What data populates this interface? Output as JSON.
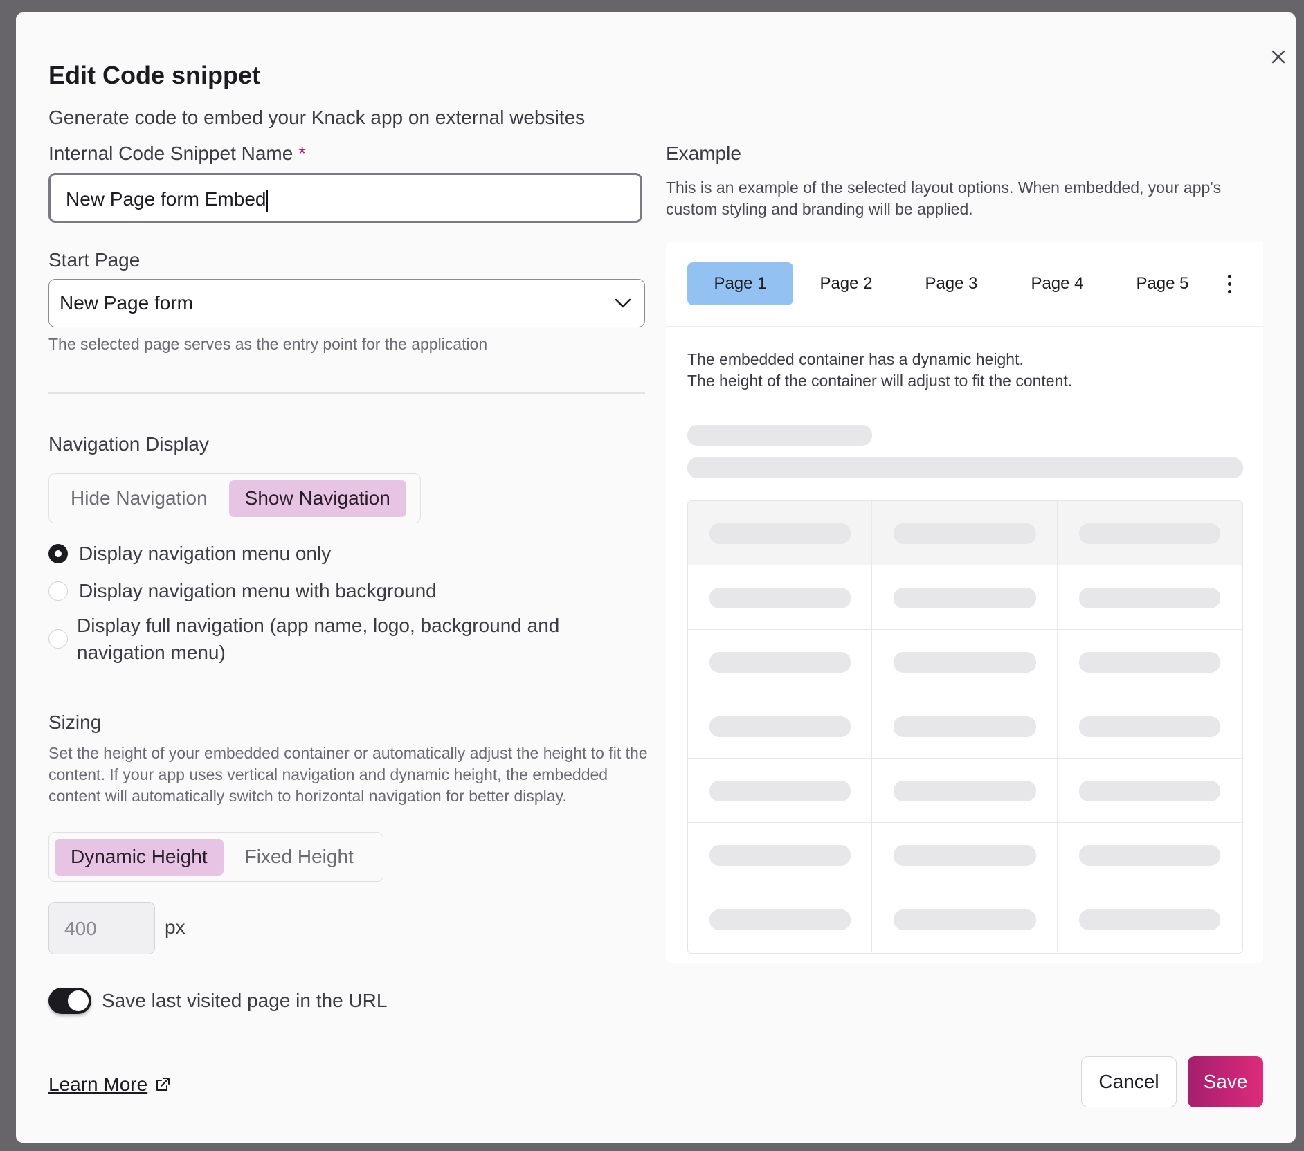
{
  "dialog": {
    "title": "Edit Code snippet",
    "subtitle": "Generate code to embed your Knack app on external websites",
    "close_icon": "close-icon"
  },
  "name_field": {
    "label": "Internal Code Snippet Name",
    "required_mark": "*",
    "value": "New Page form Embed"
  },
  "start_page": {
    "label": "Start Page",
    "value": "New Page form",
    "helper": "The selected page serves as the entry point for the application",
    "icon": "chevron-down-icon"
  },
  "navigation": {
    "label": "Navigation Display",
    "options": [
      "Hide Navigation",
      "Show Navigation"
    ],
    "selected": "Show Navigation",
    "radios": [
      {
        "label": "Display navigation menu only",
        "checked": true
      },
      {
        "label": "Display navigation menu with background",
        "checked": false
      },
      {
        "label": "Display full navigation (app name, logo, background and navigation menu)",
        "checked": false
      }
    ]
  },
  "sizing": {
    "label": "Sizing",
    "description": "Set the height of your embedded container or automatically adjust the height to fit the content. If your app uses vertical navigation and dynamic height, the embedded content will automatically switch to horizontal navigation for better display.",
    "options": [
      "Dynamic Height",
      "Fixed Height"
    ],
    "selected": "Dynamic Height",
    "height_value": "400",
    "unit": "px"
  },
  "save_url_toggle": {
    "label": "Save last visited page in the URL",
    "on": true
  },
  "footer": {
    "learn_more": "Learn More",
    "external_icon": "external-link-icon",
    "cancel": "Cancel",
    "save": "Save"
  },
  "example": {
    "label": "Example",
    "description": "This is an example of the selected layout options. When embedded, your app's custom styling and branding will be applied.",
    "tabs": [
      "Page 1",
      "Page 2",
      "Page 3",
      "Page 4",
      "Page 5"
    ],
    "active_tab": "Page 1",
    "more_icon": "more-vertical-icon",
    "line1": "The embedded container has a dynamic height.",
    "line2": "The height of the container will adjust to fit the content."
  },
  "colors": {
    "accent": "#c0246f",
    "active_segment": "#e7c4e3",
    "active_tab": "#93c2f2"
  }
}
